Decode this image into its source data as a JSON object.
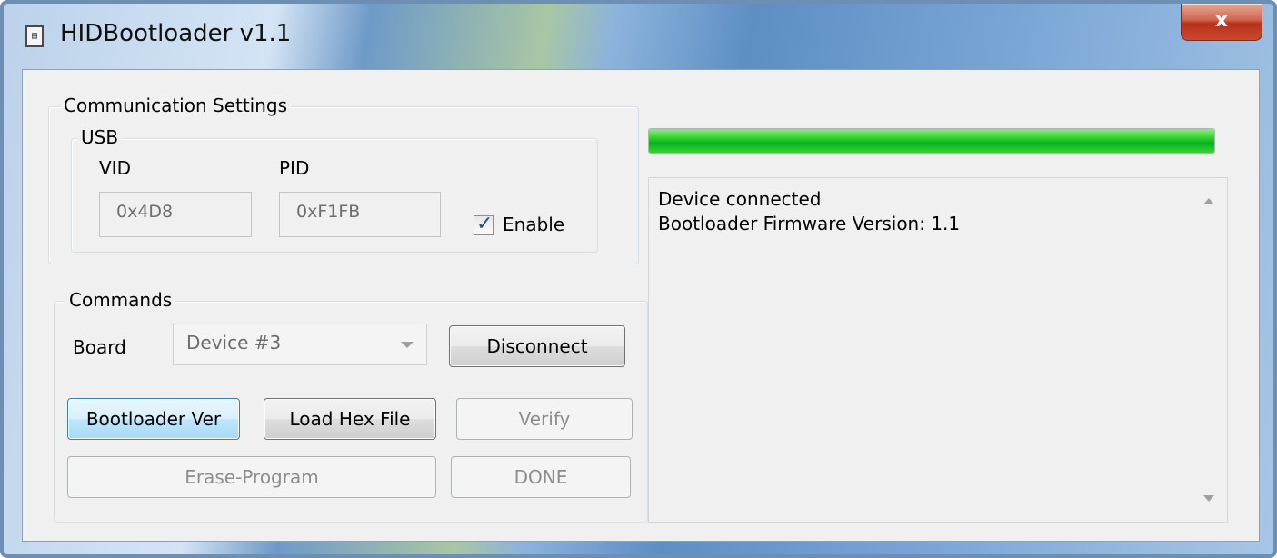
{
  "window": {
    "title": "HIDBootloader v1.1",
    "close_label": "x",
    "icon": "document-icon"
  },
  "comm": {
    "group_label": "Communication Settings",
    "usb_label": "USB",
    "vid_label": "VID",
    "pid_label": "PID",
    "vid_value": "0x4D8",
    "pid_value": "0xF1FB",
    "enable_label": "Enable",
    "enable_checked": true
  },
  "commands": {
    "group_label": "Commands",
    "board_label": "Board",
    "board_value": "Device #3",
    "disconnect_label": "Disconnect",
    "bootloader_ver_label": "Bootloader Ver",
    "load_hex_label": "Load Hex File",
    "verify_label": "Verify",
    "erase_program_label": "Erase-Program",
    "done_label": "DONE"
  },
  "progress": {
    "percent": 100,
    "color": "#06b025"
  },
  "log": {
    "lines": [
      "Device connected",
      "Bootloader Firmware Version: 1.1"
    ]
  }
}
